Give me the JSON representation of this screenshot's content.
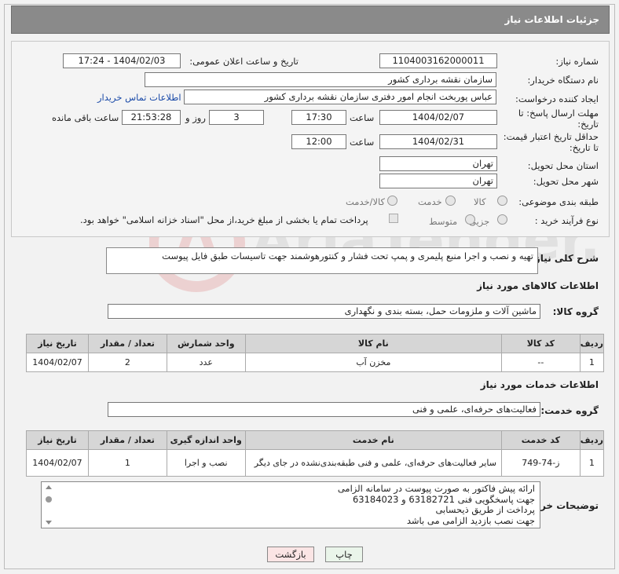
{
  "title": "جزئیات اطلاعات نیاز",
  "fields": {
    "need_number_label": "شماره نیاز:",
    "need_number": "1104003162000011",
    "announce_label": "تاریخ و ساعت اعلان عمومی:",
    "announce_value": "1404/02/03 - 17:24",
    "buyer_org_label": "نام دستگاه خریدار:",
    "buyer_org": "سازمان نقشه برداری کشور",
    "creator_label": "ایجاد کننده درخواست:",
    "creator": "عباس پوربخت انجام امور دفتری  سازمان نقشه برداری کشور",
    "contact_link": "اطلاعات تماس خریدار",
    "deadline_label": "مهلت ارسال پاسخ: تا تاریخ:",
    "deadline_date": "1404/02/07",
    "time_label": "ساعت",
    "deadline_time": "17:30",
    "days_value": "3",
    "days_label": "روز و",
    "remaining_time": "21:53:28",
    "remaining_label": "ساعت باقی مانده",
    "min_validity_label": "حداقل تاریخ اعتبار قیمت: تا تاریخ:",
    "validity_date": "1404/02/31",
    "validity_time": "12:00",
    "province_label": "استان محل تحویل:",
    "province": "تهران",
    "city_label": "شهر محل تحویل:",
    "city": "تهران",
    "category_label": "طبقه بندی موضوعی:",
    "category_options": [
      "کالا",
      "خدمت",
      "کالا/خدمت"
    ],
    "process_label": "نوع فرآیند خرید :",
    "process_options": [
      "جزیی",
      "متوسط"
    ],
    "payment_note": "پرداخت تمام یا بخشی از مبلغ خرید،از محل \"اسناد خزانه اسلامی\" خواهد بود."
  },
  "description": {
    "label": "شرح کلی نیاز:",
    "text": "تهیه و نصب و اجرا منبع پلیمری و پمپ تحت فشار و کنتورهوشمند جهت تاسیسات طبق فایل پیوست"
  },
  "goods": {
    "section_title": "اطلاعات کالاهای مورد نیاز",
    "group_label": "گروه کالا:",
    "group_value": "ماشین آلات و ملزومات حمل، بسته بندی و نگهداری",
    "headers": [
      "ردیف",
      "کد کالا",
      "نام کالا",
      "واحد شمارش",
      "تعداد / مقدار",
      "تاریخ نیاز"
    ],
    "rows": [
      [
        "1",
        "--",
        "مخزن آب",
        "عدد",
        "2",
        "1404/02/07"
      ]
    ]
  },
  "services": {
    "section_title": "اطلاعات خدمات مورد نیاز",
    "group_label": "گروه خدمت:",
    "group_value": "فعالیت‌های حرفه‌ای، علمی و فنی",
    "headers": [
      "ردیف",
      "کد خدمت",
      "نام خدمت",
      "واحد اندازه گیری",
      "تعداد / مقدار",
      "تاریخ نیاز"
    ],
    "rows": [
      [
        "1",
        "ز-74-749",
        "سایر فعالیت‌های حرفه‌ای، علمی و فنی طبقه‌بندی‌نشده در جای دیگر",
        "نصب و اجرا",
        "1",
        "1404/02/07"
      ]
    ]
  },
  "buyer_notes": {
    "label": "توضیحات خریدار:",
    "lines": [
      "ارائه پیش فاکتور به صورت پیوست در سامانه الزامی",
      "جهت پاسخگویی فنی 63182721 و 63184023",
      "پرداخت از طریق ذیحسابی",
      "جهت نصب بازدید الزامی می باشد"
    ]
  },
  "buttons": {
    "print": "چاپ",
    "back": "بازگشت"
  },
  "watermark": "AriaTender.net"
}
